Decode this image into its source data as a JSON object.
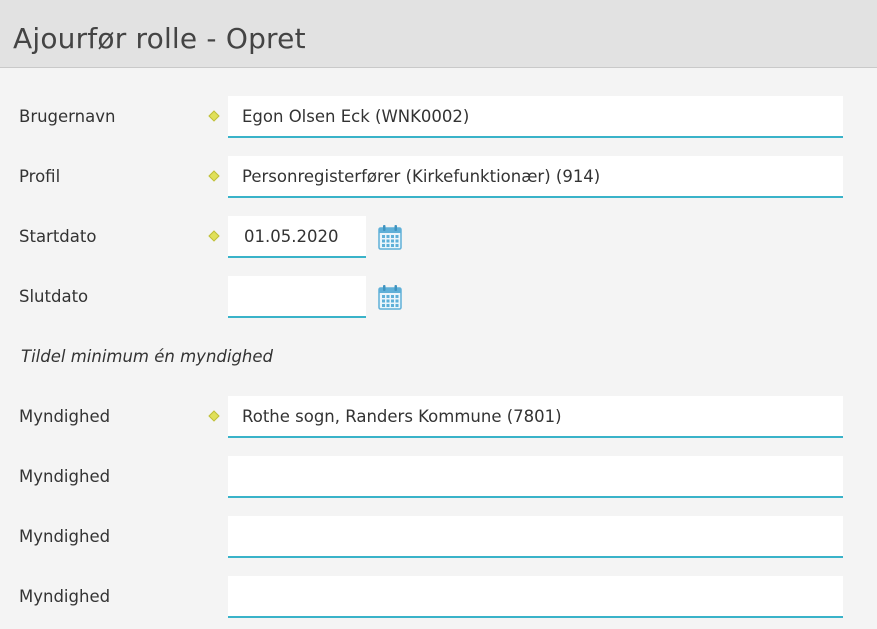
{
  "header": {
    "title": "Ajourfør rolle - Opret"
  },
  "form": {
    "brugernavn": {
      "label": "Brugernavn",
      "value": "Egon Olsen Eck (WNK0002)",
      "required": true
    },
    "profil": {
      "label": "Profil",
      "value": "Personregisterfører (Kirkefunktionær) (914)",
      "required": true
    },
    "startdato": {
      "label": "Startdato",
      "value": "01.05.2020",
      "required": true,
      "icon": "calendar-icon"
    },
    "slutdato": {
      "label": "Slutdato",
      "value": "",
      "required": false,
      "icon": "calendar-icon"
    },
    "note": "Tildel minimum én myndighed",
    "myndigheder": [
      {
        "label": "Myndighed",
        "value": "Rothe sogn, Randers Kommune (7801)",
        "required": true
      },
      {
        "label": "Myndighed",
        "value": "",
        "required": false
      },
      {
        "label": "Myndighed",
        "value": "",
        "required": false
      },
      {
        "label": "Myndighed",
        "value": "",
        "required": false
      }
    ]
  },
  "colors": {
    "header_bg": "#e2e2e2",
    "page_bg": "#f4f4f4",
    "field_underline": "#3ab3c9",
    "required_marker": "#e0e05a",
    "calendar_icon": "#5fb0d8"
  }
}
